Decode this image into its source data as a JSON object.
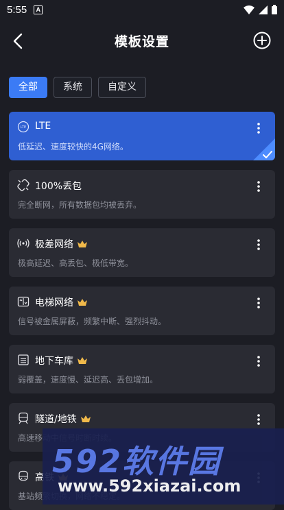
{
  "status_bar": {
    "time": "5:55",
    "app_badge": "A"
  },
  "header": {
    "title": "模板设置"
  },
  "tabs": [
    {
      "label": "全部",
      "active": true
    },
    {
      "label": "系统",
      "active": false
    },
    {
      "label": "自定义",
      "active": false
    }
  ],
  "templates": [
    {
      "icon": "lte-icon",
      "title": "LTE",
      "desc": "低延迟、速度较快的4G网络。",
      "premium": false,
      "selected": true
    },
    {
      "icon": "broken-link-icon",
      "title": "100%丢包",
      "desc": "完全断网，所有数据包均被丢弃。",
      "premium": false,
      "selected": false
    },
    {
      "icon": "weak-signal-icon",
      "title": "极差网络",
      "desc": "极高延迟、高丢包、极低带宽。",
      "premium": true,
      "selected": false
    },
    {
      "icon": "elevator-icon",
      "title": "电梯网络",
      "desc": "信号被金属屏蔽，频繁中断、强烈抖动。",
      "premium": true,
      "selected": false
    },
    {
      "icon": "garage-icon",
      "title": "地下车库",
      "desc": "弱覆盖，速度慢、延迟高、丢包增加。",
      "premium": true,
      "selected": false
    },
    {
      "icon": "subway-icon",
      "title": "隧道/地铁",
      "desc": "高速移动中信号时断时续。",
      "premium": true,
      "selected": false
    },
    {
      "icon": "train-icon",
      "title": "高铁",
      "desc": "基站频繁切换，网络不稳定。",
      "premium": true,
      "selected": false
    }
  ],
  "watermark": {
    "logo_text": "592软件园",
    "url": "www.592xiazai.com"
  },
  "colors": {
    "accent": "#3b7bf5",
    "selected_card": "#2f5fd2",
    "card": "#2a2b33",
    "background": "#1c1d24",
    "crown": "#f0b94a"
  }
}
